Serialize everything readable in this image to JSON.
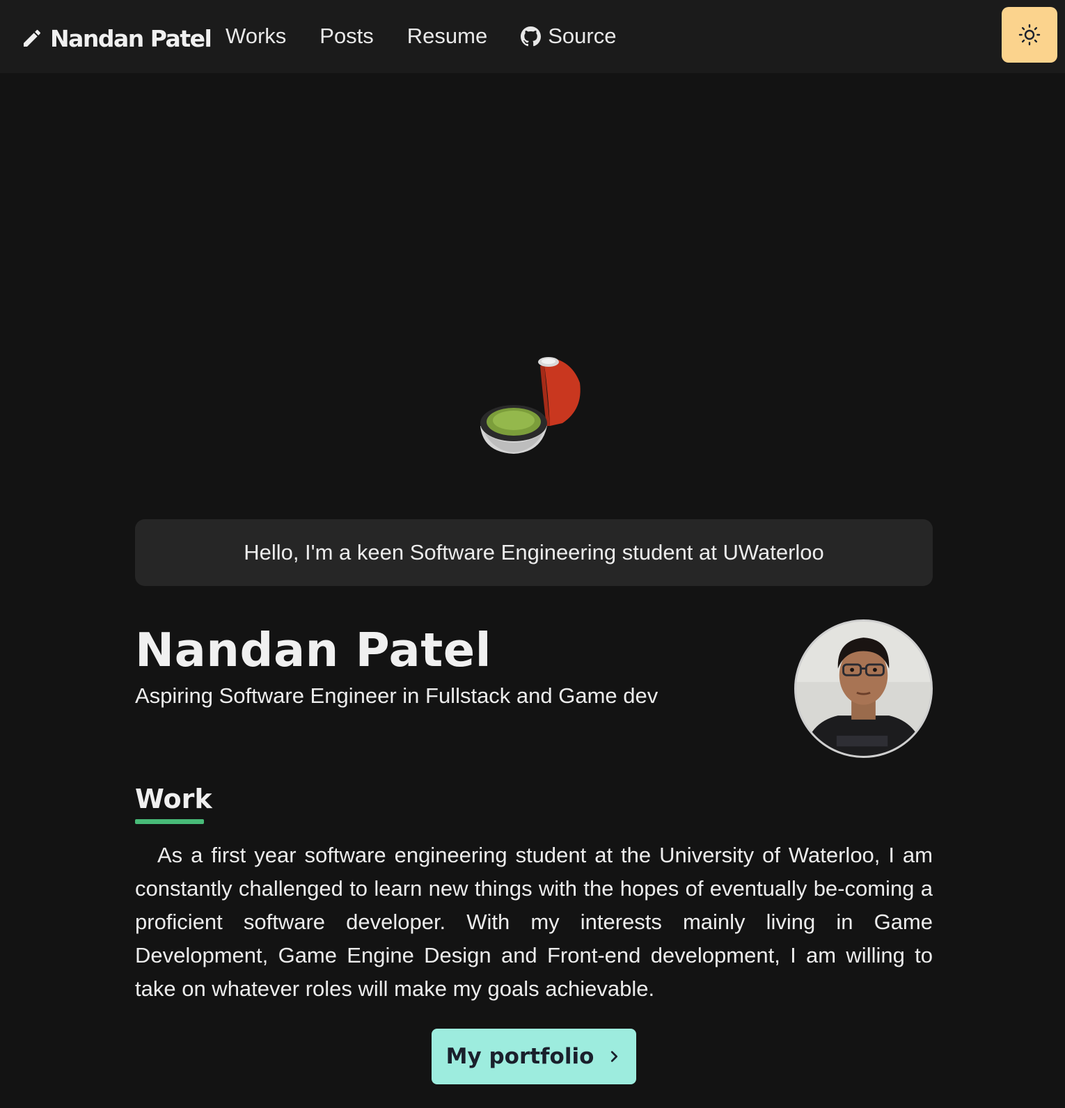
{
  "navbar": {
    "logo_text": "Nandan Patel",
    "links": [
      {
        "label": "Works"
      },
      {
        "label": "Posts"
      },
      {
        "label": "Resume"
      },
      {
        "label": "Source",
        "icon": "github-icon"
      }
    ],
    "theme_toggle_icon": "sun-icon"
  },
  "hero": {
    "model": "voxel-pokeball-open-icon"
  },
  "greeting": "Hello, I'm a keen Software Engineering student at UWaterloo",
  "profile": {
    "name": "Nandan Patel",
    "tagline": "Aspiring Software Engineer in Fullstack and Game dev"
  },
  "work": {
    "heading": "Work",
    "body": "As a first year software engineering student at the University of Waterloo, I am constantly challenged to learn new things with the hopes of eventually be-coming a proficient software developer. With my interests mainly living in Game Development, Game Engine Design and Front-end development, I am willing to take on whatever roles will make my goals achievable.",
    "button_label": "My portfolio"
  },
  "colors": {
    "background": "#131313",
    "navbar": "#1b1b1b",
    "theme_button": "#fbd38d",
    "accent_underline": "#48bb78",
    "portfolio_button": "#9decde"
  }
}
